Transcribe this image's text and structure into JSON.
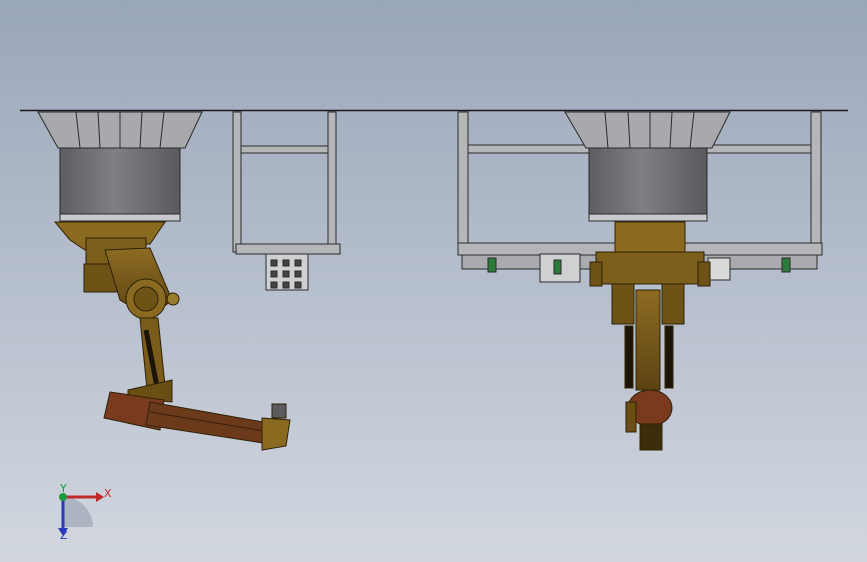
{
  "triad": {
    "x_label": "X",
    "y_label": "Y",
    "z_label": "Z",
    "x_color": "#c0282a",
    "y_color": "#1a9a3a",
    "z_color": "#2a3ab8"
  },
  "colors": {
    "background_top": "#9aa6ba",
    "background_bottom": "#d2d7df",
    "frame": "#b4b6b9",
    "cylinder": "#76767a",
    "robot": "#7d5f1c",
    "robot_dark": "#3e2d0b"
  }
}
